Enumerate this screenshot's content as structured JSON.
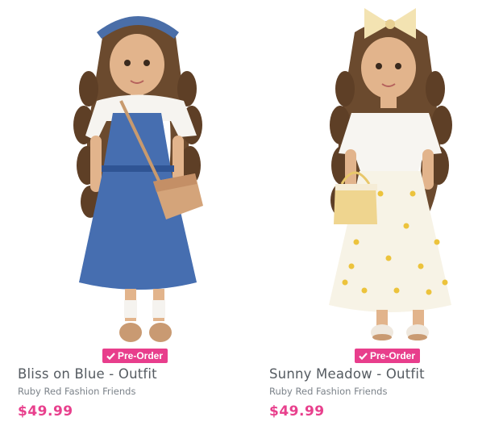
{
  "products": [
    {
      "title": "Bliss on Blue - Outfit",
      "brand": "Ruby Red Fashion Friends",
      "price": "$49.99",
      "badge": "Pre-Order",
      "image_icon": "doll-blue-dress-image"
    },
    {
      "title": "Sunny Meadow - Outfit",
      "brand": "Ruby Red Fashion Friends",
      "price": "$49.99",
      "badge": "Pre-Order",
      "image_icon": "doll-yellow-floral-image"
    }
  ],
  "colors": {
    "accent": "#e83e8c",
    "price": "#e8408d",
    "title": "#555b61",
    "brand": "#7c838a"
  }
}
